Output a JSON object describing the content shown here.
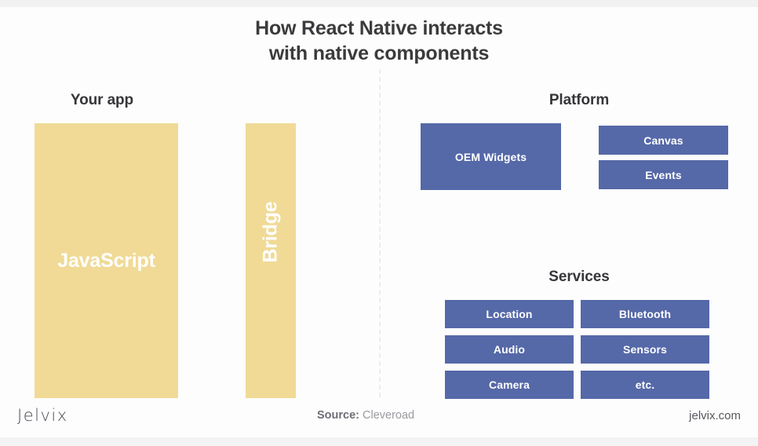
{
  "title": {
    "line1": "How React Native interacts",
    "line2": "with native components"
  },
  "sections": {
    "your_app": {
      "heading": "Your app",
      "javascript_label": "JavaScript",
      "bridge_label": "Bridge"
    },
    "platform": {
      "heading": "Platform",
      "boxes": [
        {
          "label": "OEM Widgets"
        },
        {
          "label": "Canvas"
        },
        {
          "label": "Events"
        }
      ]
    },
    "services": {
      "heading": "Services",
      "boxes": [
        {
          "label": "Location"
        },
        {
          "label": "Bluetooth"
        },
        {
          "label": "Audio"
        },
        {
          "label": "Sensors"
        },
        {
          "label": "Camera"
        },
        {
          "label": "etc."
        }
      ]
    }
  },
  "footer": {
    "logo": "Jelvix",
    "source_label": "Source:",
    "source_value": "Cleveroad",
    "website": "jelvix.com"
  },
  "colors": {
    "yellow": "#F0DA96",
    "blue": "#5568A8",
    "title_text": "#3B3B3D",
    "background": "#FDFDFD",
    "divider": "#ECECEE"
  }
}
